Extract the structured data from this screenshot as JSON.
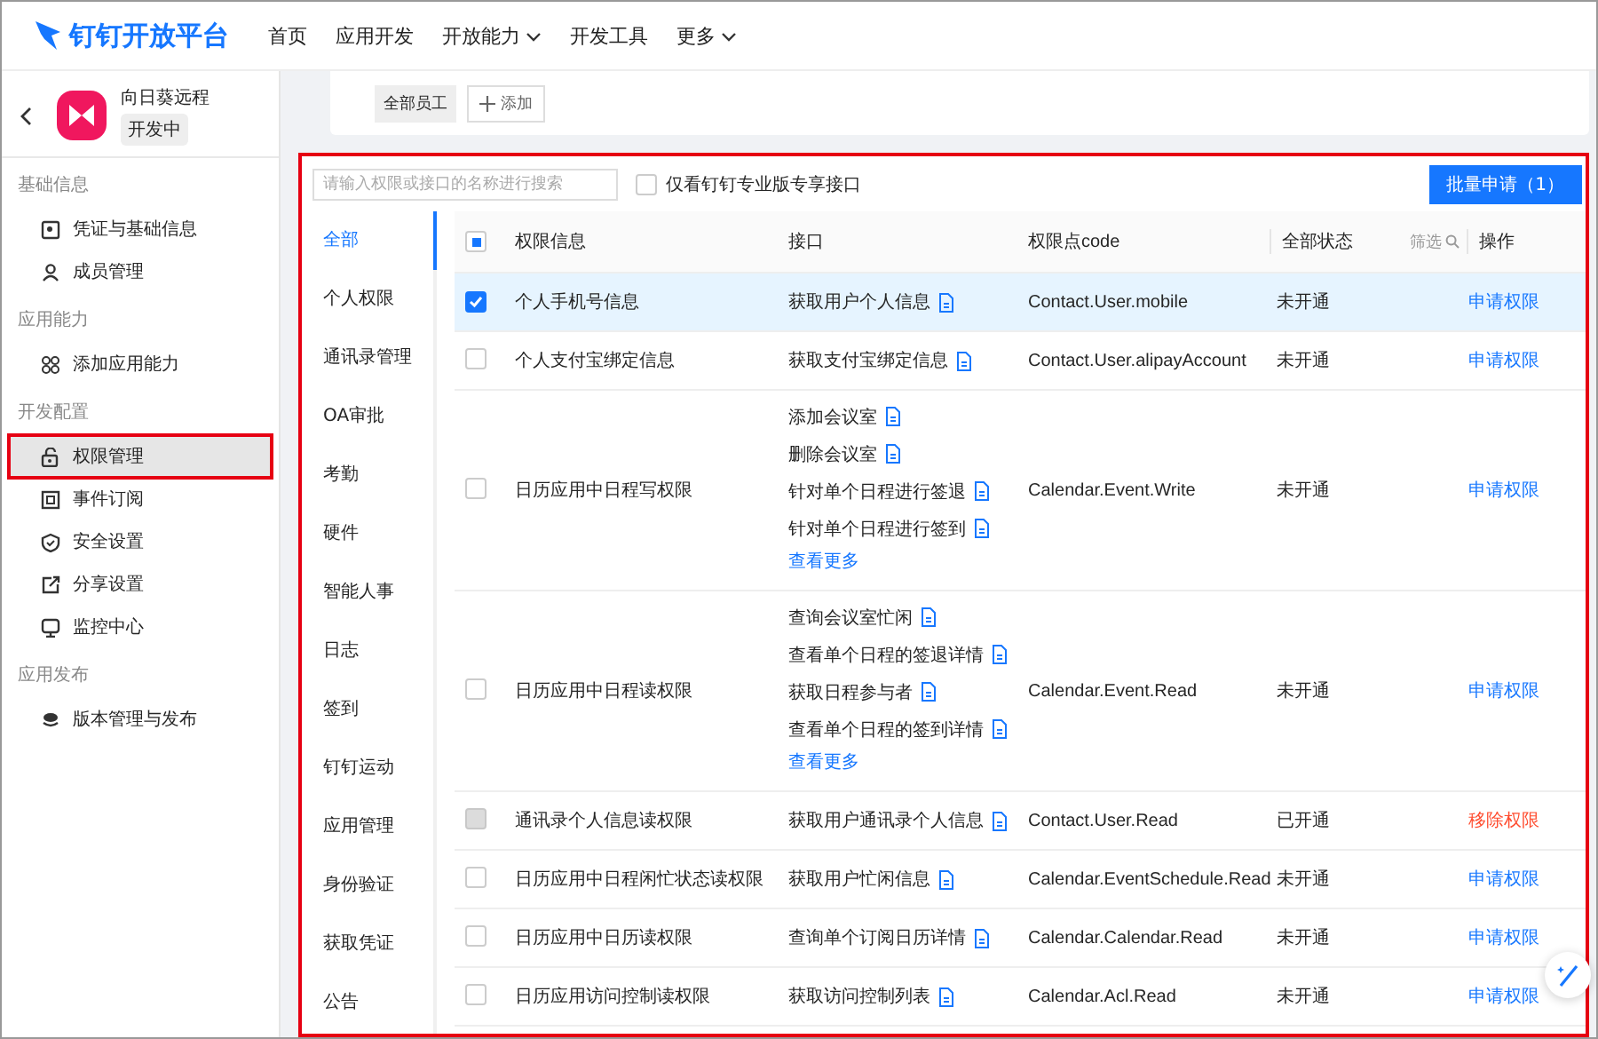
{
  "header": {
    "logo": "钉钉开放平台",
    "nav": [
      {
        "label": "首页",
        "dropdown": false
      },
      {
        "label": "应用开发",
        "dropdown": false
      },
      {
        "label": "开放能力",
        "dropdown": true
      },
      {
        "label": "开发工具",
        "dropdown": false
      },
      {
        "label": "更多",
        "dropdown": true
      }
    ]
  },
  "sidebar": {
    "app": {
      "name": "向日葵远程",
      "status": "开发中"
    },
    "sections": [
      {
        "title": "基础信息",
        "items": [
          {
            "label": "凭证与基础信息",
            "selected": false,
            "highlighted": false
          },
          {
            "label": "成员管理",
            "selected": false,
            "highlighted": false
          }
        ]
      },
      {
        "title": "应用能力",
        "items": [
          {
            "label": "添加应用能力",
            "selected": false,
            "highlighted": false
          }
        ]
      },
      {
        "title": "开发配置",
        "items": [
          {
            "label": "权限管理",
            "selected": true,
            "highlighted": true
          },
          {
            "label": "事件订阅",
            "selected": false,
            "highlighted": false
          },
          {
            "label": "安全设置",
            "selected": false,
            "highlighted": false
          },
          {
            "label": "分享设置",
            "selected": false,
            "highlighted": false
          },
          {
            "label": "监控中心",
            "selected": false,
            "highlighted": false
          }
        ]
      },
      {
        "title": "应用发布",
        "items": [
          {
            "label": "版本管理与发布",
            "selected": false,
            "highlighted": false
          }
        ]
      }
    ]
  },
  "scope": {
    "tags": [
      "全部员工"
    ],
    "add_button": "添加"
  },
  "panel": {
    "highlighted": true,
    "search": {
      "placeholder": "请输入权限或接口的名称进行搜索"
    },
    "pro_only": {
      "label": "仅看钉钉专业版专享接口",
      "checked": false
    },
    "batch_button": "批量申请（1）",
    "categories": [
      {
        "label": "全部",
        "selected": true
      },
      {
        "label": "个人权限",
        "selected": false
      },
      {
        "label": "通讯录管理",
        "selected": false
      },
      {
        "label": "OA审批",
        "selected": false
      },
      {
        "label": "考勤",
        "selected": false
      },
      {
        "label": "硬件",
        "selected": false
      },
      {
        "label": "智能人事",
        "selected": false
      },
      {
        "label": "日志",
        "selected": false
      },
      {
        "label": "签到",
        "selected": false
      },
      {
        "label": "钉钉运动",
        "selected": false
      },
      {
        "label": "应用管理",
        "selected": false
      },
      {
        "label": "身份验证",
        "selected": false
      },
      {
        "label": "获取凭证",
        "selected": false
      },
      {
        "label": "公告",
        "selected": false
      }
    ],
    "table": {
      "select_all": {
        "partial": true
      },
      "columns": [
        {
          "label": "权限信息"
        },
        {
          "label": "接口"
        },
        {
          "label": "权限点code"
        },
        {
          "label": "全部状态",
          "filter": "筛选"
        },
        {
          "label": "操作"
        }
      ],
      "rows": [
        {
          "selected": true,
          "disabled": false,
          "name": "个人手机号信息",
          "apis": [
            "获取用户个人信息"
          ],
          "code": "Contact.User.mobile",
          "status": "未开通",
          "action": {
            "kind": "apply",
            "label": "申请权限"
          }
        },
        {
          "selected": false,
          "disabled": false,
          "name": "个人支付宝绑定信息",
          "apis": [
            "获取支付宝绑定信息"
          ],
          "code": "Contact.User.alipayAccount",
          "status": "未开通",
          "action": {
            "kind": "apply",
            "label": "申请权限"
          }
        },
        {
          "selected": false,
          "disabled": false,
          "name": "日历应用中日程写权限",
          "apis": [
            "添加会议室",
            "删除会议室",
            "针对单个日程进行签退",
            "针对单个日程进行签到"
          ],
          "more": "查看更多",
          "code": "Calendar.Event.Write",
          "status": "未开通",
          "action": {
            "kind": "apply",
            "label": "申请权限"
          }
        },
        {
          "selected": false,
          "disabled": false,
          "name": "日历应用中日程读权限",
          "apis": [
            "查询会议室忙闲",
            "查看单个日程的签退详情",
            "获取日程参与者",
            "查看单个日程的签到详情"
          ],
          "more": "查看更多",
          "code": "Calendar.Event.Read",
          "status": "未开通",
          "action": {
            "kind": "apply",
            "label": "申请权限"
          }
        },
        {
          "selected": false,
          "disabled": true,
          "name": "通讯录个人信息读权限",
          "apis": [
            "获取用户通讯录个人信息"
          ],
          "code": "Contact.User.Read",
          "status": "已开通",
          "action": {
            "kind": "remove",
            "label": "移除权限"
          }
        },
        {
          "selected": false,
          "disabled": false,
          "name": "日历应用中日程闲忙状态读权限",
          "apis": [
            "获取用户忙闲信息"
          ],
          "code": "Calendar.EventSchedule.Read",
          "status": "未开通",
          "action": {
            "kind": "apply",
            "label": "申请权限"
          }
        },
        {
          "selected": false,
          "disabled": false,
          "name": "日历应用中日历读权限",
          "apis": [
            "查询单个订阅日历详情"
          ],
          "code": "Calendar.Calendar.Read",
          "status": "未开通",
          "action": {
            "kind": "apply",
            "label": "申请权限"
          }
        },
        {
          "selected": false,
          "disabled": false,
          "name": "日历应用访问控制读权限",
          "apis": [
            "获取访问控制列表"
          ],
          "code": "Calendar.Acl.Read",
          "status": "未开通",
          "action": {
            "kind": "apply",
            "label": "申请权限"
          }
        }
      ]
    }
  }
}
